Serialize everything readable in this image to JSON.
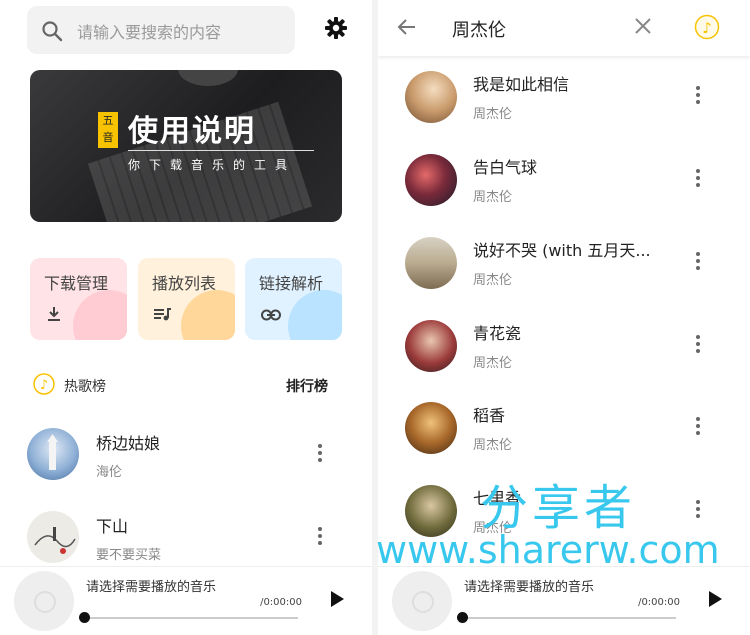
{
  "left": {
    "search": {
      "placeholder": "请输入要搜索的内容"
    },
    "banner": {
      "badge": "五音",
      "title": "使用说明",
      "subtitle": "你下载音乐的工具"
    },
    "cards": [
      {
        "label": "下载管理",
        "icon": "download-icon"
      },
      {
        "label": "播放列表",
        "icon": "playlist-icon"
      },
      {
        "label": "链接解析",
        "icon": "link-icon"
      }
    ],
    "hot": {
      "title": "热歌榜",
      "rank_label": "排行榜"
    },
    "songs": [
      {
        "title": "桥边姑娘",
        "artist": "海伦"
      },
      {
        "title": "下山",
        "artist": "要不要买菜"
      }
    ],
    "player": {
      "hint": "请选择需要播放的音乐",
      "time": "/0:00:00"
    }
  },
  "right": {
    "query": "周杰伦",
    "songs": [
      {
        "title": "我是如此相信",
        "artist": "周杰伦"
      },
      {
        "title": "告白气球",
        "artist": "周杰伦"
      },
      {
        "title": "说好不哭 (with 五月天...",
        "artist": "周杰伦"
      },
      {
        "title": "青花瓷",
        "artist": "周杰伦"
      },
      {
        "title": "稻香",
        "artist": "周杰伦"
      },
      {
        "title": "七里香",
        "artist": "周杰伦"
      }
    ],
    "player": {
      "hint": "请选择需要播放的音乐",
      "time": "/0:00:00"
    }
  },
  "watermark": {
    "line1": "分享者",
    "line2": "www.sharerw.com"
  },
  "colors": {
    "accent": "#f7c300",
    "watermark": "#38c8ee"
  }
}
